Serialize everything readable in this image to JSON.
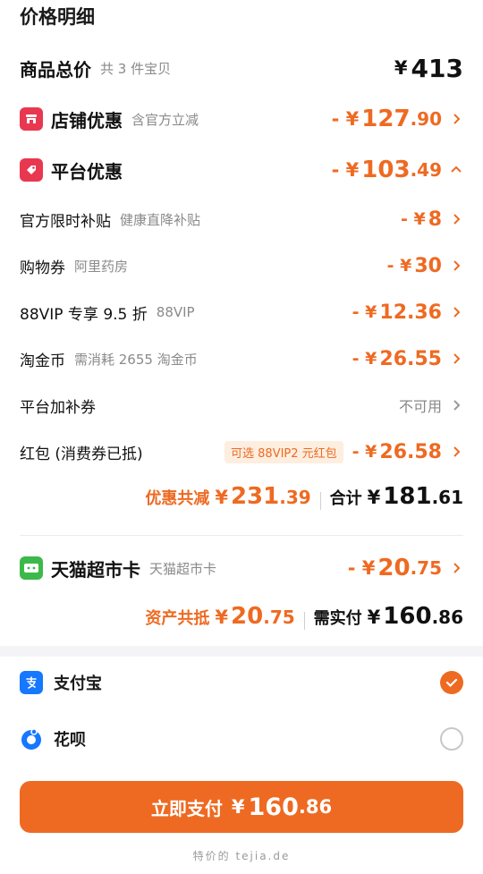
{
  "header": {
    "title": "价格明细"
  },
  "total": {
    "label": "商品总价",
    "hint": "共 3 件宝贝",
    "yen": "¥",
    "amount": "413"
  },
  "shop": {
    "label": "店铺优惠",
    "hint": "含官方立减",
    "prefix": "- ¥",
    "int": "127",
    "dec": ".90",
    "icon": "shop-icon",
    "color": "#e8384f"
  },
  "platform": {
    "label": "平台优惠",
    "prefix": "- ¥",
    "int": "103",
    "dec": ".49",
    "icon": "tag-icon",
    "color": "#e8384f"
  },
  "items": [
    {
      "label": "官方限时补贴",
      "hint": "健康直降补贴",
      "prefix": "- ¥",
      "amount": "8"
    },
    {
      "label": "购物券",
      "hint": "阿里药房",
      "prefix": "- ¥",
      "amount": "30"
    },
    {
      "label": "88VIP 专享 9.5 折",
      "hint": "88VIP",
      "prefix": "- ¥",
      "amount": "12.36"
    },
    {
      "label": "淘金币",
      "hint": "需消耗 2655 淘金币",
      "prefix": "- ¥",
      "amount": "26.55"
    },
    {
      "label": "平台加补券",
      "hint": "",
      "status": "不可用"
    },
    {
      "label": "红包 (消费券已抵)",
      "badge": "可选 88VIP2 元红包",
      "prefix": "- ¥",
      "amount": "26.58"
    }
  ],
  "discount_summary": {
    "label": "优惠共减",
    "yen": "¥",
    "int": "231",
    "dec": ".39",
    "total_label": "合计",
    "total_yen": "¥",
    "total_int": "181",
    "total_dec": ".61"
  },
  "tmall": {
    "label": "天猫超市卡",
    "hint": "天猫超市卡",
    "prefix": "- ¥",
    "int": "20",
    "dec": ".75",
    "icon": "tmall-card-icon",
    "color": "#3cb94a"
  },
  "asset_summary": {
    "label": "资产共抵",
    "yen": "¥",
    "int": "20",
    "dec": ".75",
    "pay_label": "需实付",
    "pay_yen": "¥",
    "pay_int": "160",
    "pay_dec": ".86"
  },
  "payment_methods": [
    {
      "label": "支付宝",
      "icon": "alipay-icon",
      "selected": true
    },
    {
      "label": "花呗",
      "icon": "huabei-icon",
      "selected": false
    }
  ],
  "pay_button": {
    "label": "立即支付",
    "yen": "¥",
    "int": "160",
    "dec": ".86"
  },
  "watermark": "特价的 tejia.de",
  "colors": {
    "accent": "#ee6a22",
    "red": "#e8384f",
    "green": "#3cb94a",
    "blue": "#1677ff"
  }
}
